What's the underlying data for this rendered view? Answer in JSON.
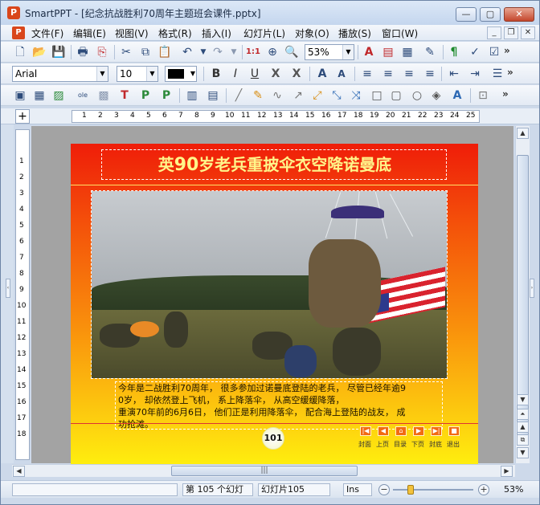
{
  "window": {
    "app_icon": "P",
    "title": "SmartPPT - [纪念抗战胜利70周年主题班会课件.pptx]",
    "minimize": "—",
    "maximize": "▢",
    "close": "✕"
  },
  "menu": {
    "doc_icon": "P",
    "items": [
      "文件(F)",
      "编辑(E)",
      "视图(V)",
      "格式(R)",
      "插入(I)",
      "幻灯片(L)",
      "对象(O)",
      "播放(S)",
      "窗口(W)"
    ],
    "mdi_min": "_",
    "mdi_restore": "❐",
    "mdi_close": "✕"
  },
  "toolbar1": {
    "zoom_value": "53%",
    "icons": [
      "new-icon",
      "open-icon",
      "save-icon",
      "print-icon",
      "pdf-icon",
      "cut-icon",
      "copy-icon",
      "paste-icon",
      "undo-icon",
      "redo-icon",
      "slide-size-icon",
      "zoom-icon",
      "find-icon",
      "text-a-icon",
      "format-icon",
      "notes-icon",
      "brush-icon",
      "paragraph-icon",
      "spell-icon",
      "check-icon"
    ]
  },
  "toolbar2": {
    "font_name": "Arial",
    "font_size": "10",
    "bold": "B",
    "italic": "I",
    "underline": "U",
    "strike": "X",
    "shadow": "X",
    "grow": "A",
    "shrink": "A"
  },
  "ruler": {
    "corner": "+",
    "h_numbers": [
      "1",
      "2",
      "3",
      "4",
      "5",
      "6",
      "7",
      "8",
      "9",
      "10",
      "11",
      "12",
      "13",
      "14",
      "15",
      "16",
      "17",
      "18",
      "19",
      "20",
      "21",
      "22",
      "23",
      "24",
      "25"
    ],
    "v_numbers": [
      "1",
      "2",
      "3",
      "4",
      "5",
      "6",
      "7",
      "8",
      "9",
      "10",
      "11",
      "12",
      "13",
      "14",
      "15",
      "16",
      "17",
      "18"
    ]
  },
  "slide": {
    "title_prefix": "英",
    "title_number": "90",
    "title_suffix": "岁老兵重披伞衣空降诺曼底",
    "body_line1": "今年是二战胜利70周年， 很多参加过诺曼底登陆的老兵， 尽管已经年逾9",
    "body_line2": "0岁， 却依然登上飞机， 系上降落伞， 从高空缓缓降落，",
    "body_line3": "重演70年前的6月6日， 他们正是利用降落伞， 配合海上登陆的战友， 成",
    "body_line4": "功抢滩。",
    "page_number": "101",
    "nav": {
      "buttons": [
        "|◀",
        "◀",
        "⌂",
        "▶",
        "▶|",
        "■"
      ],
      "labels": [
        "封面",
        "上页",
        "目录",
        "下页",
        "封底",
        "退出"
      ]
    }
  },
  "status": {
    "total": "第 105 个幻灯",
    "current": "幻灯片105",
    "mode": "Ins",
    "zoom": "53%",
    "zoom_minus": "−",
    "zoom_plus": "+"
  }
}
